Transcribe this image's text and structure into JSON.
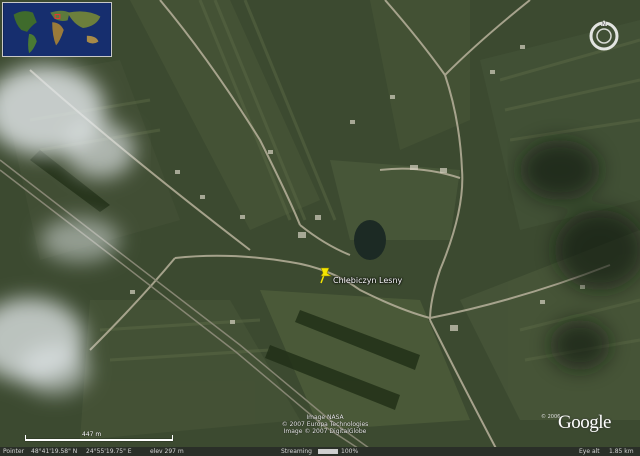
{
  "map": {
    "placemark_label": "Chlebiczyn Lesny",
    "scale_label": "447 m"
  },
  "credits": {
    "line1": "Image NASA",
    "line2": "© 2007 Europa Technologies",
    "line3": "Image © 2007 DigitalGlobe"
  },
  "logo": {
    "copyright_year": "© 2006",
    "name": "Google"
  },
  "status_bar": {
    "pointer_label": "Pointer",
    "latitude": "48°41'19.58\" N",
    "longitude": "24°55'19.75\" E",
    "elev": "elev  297 m",
    "streaming_label": "Streaming",
    "streaming_percent": "100%",
    "streaming_fraction": 1.0,
    "eye_alt_label": "Eye alt",
    "eye_alt_value": "1.85 km"
  },
  "colors": {
    "placemark": "#f5e600",
    "terrain": "#3c4a30",
    "road": "#b8b29c"
  },
  "icons": [
    "overview-globe-icon",
    "compass-icon",
    "pushpin-icon"
  ]
}
